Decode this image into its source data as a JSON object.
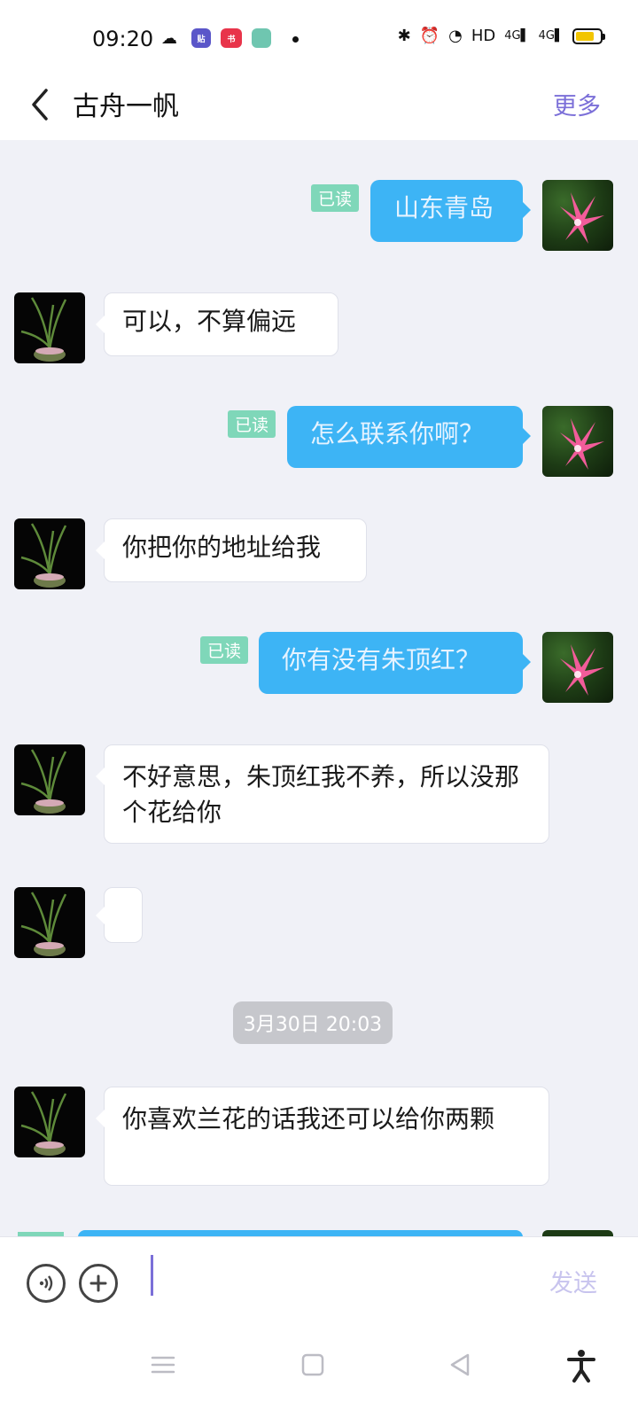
{
  "status_bar": {
    "time": "09:20",
    "network_hd": "HD",
    "signal1": "4G",
    "signal2": "4G",
    "battery_level": 0.75
  },
  "header": {
    "title": "古舟一帆",
    "more_label": "更多"
  },
  "messages": [
    {
      "side": "out",
      "text": "山东青岛",
      "read": "已读"
    },
    {
      "side": "in",
      "text": "可以，不算偏远"
    },
    {
      "side": "out",
      "text": "怎么联系你啊？",
      "read": "已读"
    },
    {
      "side": "in",
      "text": "你把你的地址给我"
    },
    {
      "side": "out",
      "text": "你有没有朱顶红？",
      "read": "已读"
    },
    {
      "side": "in",
      "text": "不好意思，朱顶红我不养，所以没那个花给你"
    },
    {
      "side": "in",
      "text": ""
    },
    {
      "side": "in",
      "text": "你喜欢兰花的话我还可以给你两颗"
    }
  ],
  "timestamp": "3月30日 20:03",
  "input": {
    "send_label": "发送",
    "value": ""
  },
  "colors": {
    "accent": "#7b6fd8",
    "out_bubble": "#3db4f5",
    "read_badge": "#7fd7b9",
    "background": "#f0f1f7"
  }
}
